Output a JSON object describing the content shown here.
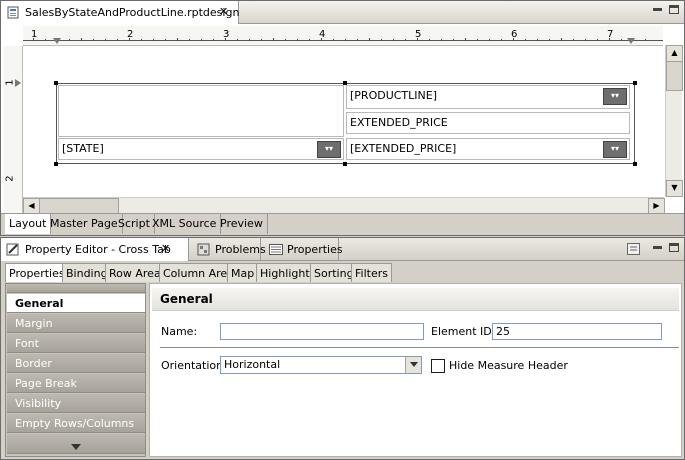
{
  "editor": {
    "file_tab": "SalesByStateAndProductLine.rptdesign",
    "ruler_numbers": [
      "1",
      "2",
      "3",
      "4",
      "5",
      "6",
      "7"
    ],
    "vruler_numbers": [
      "1",
      "2"
    ],
    "cells": {
      "productline": "[PRODUCTLINE]",
      "extended_price_header": "EXTENDED_PRICE",
      "state": "[STATE]",
      "extended_price_measure": "[EXTENDED_PRICE]"
    },
    "bottom_tabs": [
      "Layout",
      "Master Page",
      "Script",
      "XML Source",
      "Preview"
    ]
  },
  "view": {
    "tabs": [
      "Property Editor - Cross Tab",
      "Problems",
      "Properties"
    ],
    "property_tabs": [
      "Properties",
      "Binding",
      "Row Area",
      "Column Area",
      "Map",
      "Highlights",
      "Sorting",
      "Filters"
    ],
    "categories": [
      "General",
      "Margin",
      "Font",
      "Border",
      "Page Break",
      "Visibility",
      "Empty Rows/Columns"
    ],
    "section_title": "General",
    "fields": {
      "name_label": "Name:",
      "name_value": "",
      "element_id_label": "Element ID:",
      "element_id_value": "25",
      "orientation_label": "Orientation:",
      "orientation_value": "Horizontal",
      "hide_measure_label": "Hide Measure Header",
      "hide_measure_checked": false
    }
  }
}
